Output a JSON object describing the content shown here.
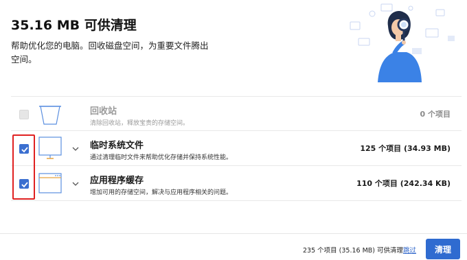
{
  "header": {
    "title": "35.16 MB 可供清理",
    "description": "帮助优化您的电脑。回收磁盘空间，为重要文件腾出空间。"
  },
  "items": [
    {
      "title": "回收站",
      "description": "清除回收站，释放宝贵的存储空间。",
      "count": "0 个项目",
      "checked": false,
      "disabled": true,
      "icon": "recycle-bin-icon"
    },
    {
      "title": "临时系统文件",
      "description": "通过清理临时文件来帮助优化存储并保持系统性能。",
      "count": "125 个项目 (34.93 MB)",
      "checked": true,
      "disabled": false,
      "icon": "monitor-icon"
    },
    {
      "title": "应用程序缓存",
      "description": "增加可用的存储空间，解决与应用程序相关的问题。",
      "count": "110 个项目 (242.34 KB)",
      "checked": true,
      "disabled": false,
      "icon": "app-window-icon"
    }
  ],
  "footer": {
    "summary": "235 个项目 (35.16 MB) 可供清理",
    "skip_label": "跳过",
    "clean_label": "清理"
  },
  "colors": {
    "accent": "#2f6bd0",
    "highlight": "#e02020",
    "illustration_blue": "#3b82e6"
  }
}
